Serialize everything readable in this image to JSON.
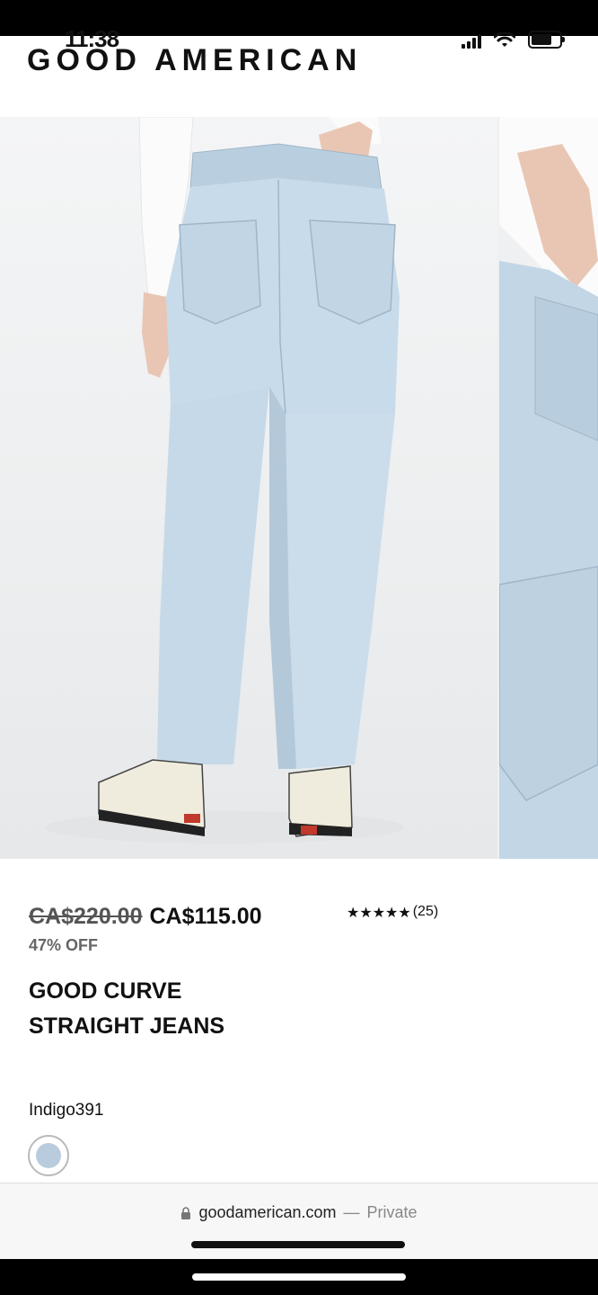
{
  "status_bar": {
    "time": "11:38",
    "icons": [
      "signal-icon",
      "wifi-icon",
      "battery-icon"
    ]
  },
  "header": {
    "brand": "GOOD AMERICAN"
  },
  "gallery": {
    "images": [
      {
        "name": "product-image-back-view",
        "subject": "light wash straight jeans, back view"
      },
      {
        "name": "product-image-detail",
        "subject": "back pocket detail"
      }
    ]
  },
  "product": {
    "price_original": "CA$220.00",
    "price_sale": "CA$115.00",
    "discount": "47% OFF",
    "rating_stars": "★★★★★",
    "rating_count": "(25)",
    "title_line1": "GOOD CURVE",
    "title_line2": "STRAIGHT JEANS",
    "color_label": "Indigo391",
    "swatch_color": "#b9ccdd"
  },
  "browser": {
    "url_host": "goodamerican.com",
    "url_sep": "—",
    "url_private": "Private"
  },
  "colors": {
    "denim": "#c8dbea",
    "denim_shadow": "#a9c0d4",
    "background": "#eef0f1"
  }
}
